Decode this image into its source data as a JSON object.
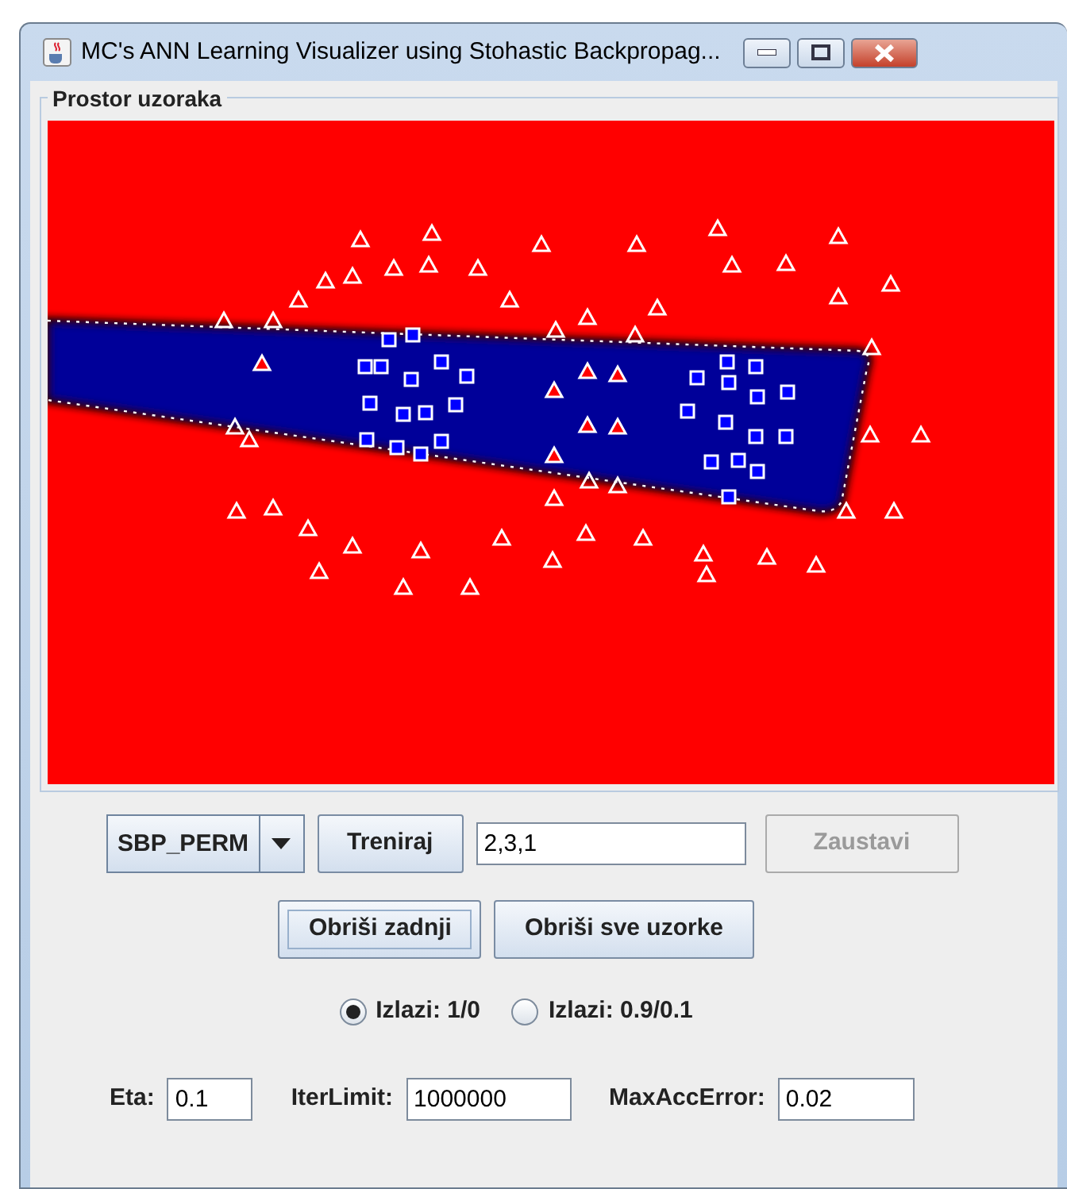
{
  "window": {
    "title": "MC's ANN Learning Visualizer using Stohastic Backpropag..."
  },
  "panel": {
    "title": "Prostor uzoraka"
  },
  "toolbar": {
    "algorithm": "SBP_PERM",
    "train_button": {
      "label": "Treniraj",
      "disabled": false
    },
    "layers": {
      "value": "2,3,1"
    },
    "stop_button": {
      "label": "Zaustavi",
      "disabled": true
    }
  },
  "delete_buttons": [
    {
      "label": "Obriši zadnji",
      "focused": true
    },
    {
      "label": "Obriši sve uzorke",
      "focused": false
    }
  ],
  "radios": [
    {
      "label": "Izlazi: 1/0",
      "selected": true
    },
    {
      "label": "Izlazi: 0.9/0.1",
      "selected": false
    }
  ],
  "params": [
    {
      "label": "Eta:",
      "value": "0.1"
    },
    {
      "label": "IterLimit:",
      "value": "1000000"
    },
    {
      "label": "MaxAccError:",
      "value": "0.02"
    }
  ]
}
